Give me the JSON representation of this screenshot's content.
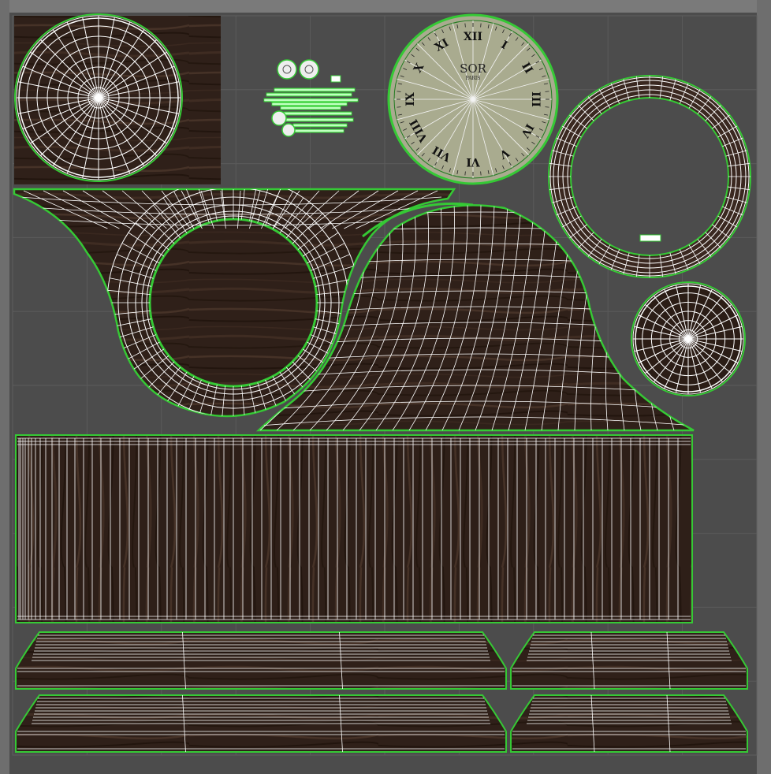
{
  "editor": {
    "view": "UV Editor",
    "background_color": "#4c4c4c",
    "grid_color": "#5b5b5b",
    "grid_divisions": 10
  },
  "colors": {
    "wood_dark": "#2b1d16",
    "wood_mid": "#3a2820",
    "wood_light": "#4a342a",
    "uv_edge": "#ffffff",
    "uv_border": "#35c935",
    "uv_border_dark": "#1f7a1f",
    "dial_face": "#a9ab8f"
  },
  "clock_dial": {
    "brand": "SOR",
    "sub_brand": "PARIS",
    "numerals": [
      "XII",
      "I",
      "II",
      "III",
      "IV",
      "V",
      "VI",
      "VII",
      "VIII",
      "IX",
      "X",
      "XI"
    ]
  },
  "uv_shells": [
    {
      "name": "round-disc-top-left",
      "icon": "circle-shell"
    },
    {
      "name": "small-parts-cluster",
      "icon": "parts-shell"
    },
    {
      "name": "clock-dial-face",
      "icon": "dial-shell"
    },
    {
      "name": "bezel-ring",
      "icon": "ring-shell"
    },
    {
      "name": "front-panel-with-hole",
      "icon": "panel-shell"
    },
    {
      "name": "arch-top-shell",
      "icon": "arch-shell"
    },
    {
      "name": "small-round-disc",
      "icon": "circle-shell"
    },
    {
      "name": "long-strip-shell",
      "icon": "strip-shell"
    },
    {
      "name": "base-moulding-shells",
      "icon": "moulding-shell"
    }
  ]
}
